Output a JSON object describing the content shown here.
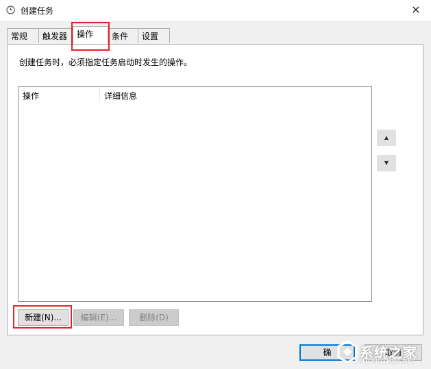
{
  "window": {
    "title": "创建任务",
    "close_glyph": "✕"
  },
  "tabs": [
    {
      "label": "常规"
    },
    {
      "label": "触发器"
    },
    {
      "label": "操作"
    },
    {
      "label": "条件"
    },
    {
      "label": "设置"
    }
  ],
  "actions": {
    "description": "创建任务时，必须指定任务启动时发生的操作。",
    "columns": [
      "操作",
      "详细信息"
    ],
    "move_up_glyph": "▲",
    "move_down_glyph": "▼",
    "new_label": "新建(N)...",
    "edit_label": "编辑(E)...",
    "delete_label": "删除(D)"
  },
  "footer": {
    "ok_label": "确",
    "cancel_label": "取消"
  },
  "watermark": {
    "text": "系统之家",
    "url": "XITONGZHIJIA.NET"
  },
  "colors": {
    "highlight": "#e0242d",
    "accent": "#0078d7"
  }
}
